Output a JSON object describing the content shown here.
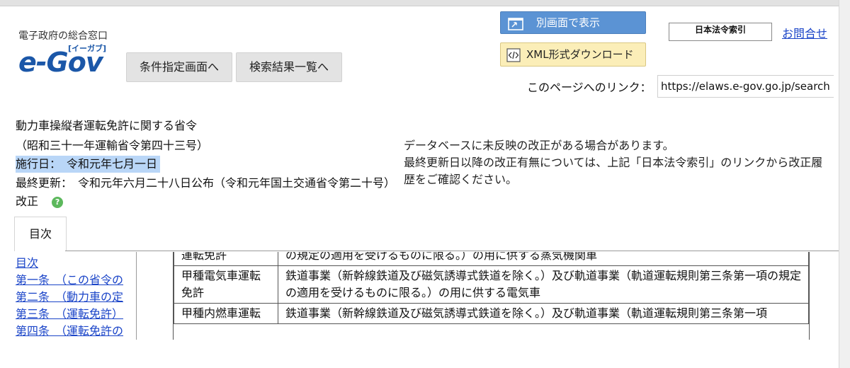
{
  "header": {
    "logo_sub": "電子政府の総合窓口",
    "logo_main": "e-Gov",
    "logo_ruby": "[イーガブ]",
    "nav_buttons": [
      "条件指定画面へ",
      "検索結果一覧へ"
    ],
    "new_window_label": "別画面で表示",
    "xml_download_label": "XML形式ダウンロード",
    "law_index_label": "日本法令索引",
    "contact_label": "お問合せ",
    "page_link_label": "このページへのリンク：",
    "page_link_value": "https://elaws.e-gov.go.jp/search"
  },
  "law": {
    "title": "動力車操縦者運転免許に関する省令",
    "number": "（昭和三十一年運輸省令第四十三号）",
    "effective_date": "施行日：　令和元年七月一日",
    "last_updated": "最終更新：　令和元年六月二十八日公布（令和元年国土交通省令第二十号）改正"
  },
  "notice": {
    "line1": "データベースに未反映の改正がある場合があります。",
    "line2": "最終更新日以降の改正有無については、上記「日本法令索引」のリンクから改正履歴をご確認ください。"
  },
  "tabs": {
    "toc_label": "目次"
  },
  "toc": {
    "items": [
      "目次",
      "第一条　（この省令の",
      "第二条　（動力車の定",
      "第三条　（運転免許）",
      "第四条　（運転免許の"
    ]
  },
  "table": {
    "rows": [
      {
        "type": "運転免許",
        "desc": "の規定の適用を受けるものに限る。）の用に供する蒸気機関車"
      },
      {
        "type": "甲種電気車運転免許",
        "desc": "鉄道事業（新幹線鉄道及び磁気誘導式鉄道を除く。）及び軌道事業（軌道運転規則第三条第一項の規定の適用を受けるものに限る。）の用に供する電気車"
      },
      {
        "type": "甲種内燃車運転",
        "desc": "鉄道事業（新幹線鉄道及び磁気誘導式鉄道を除く。）及び軌道事業（軌道運転規則第三条第一項"
      }
    ]
  },
  "colors": {
    "accent_blue": "#5b93d4",
    "link_blue": "#1a44c8",
    "xml_yellow": "#fbeeb8",
    "highlight": "#b9d6f7",
    "help_green": "#5cb85c"
  }
}
